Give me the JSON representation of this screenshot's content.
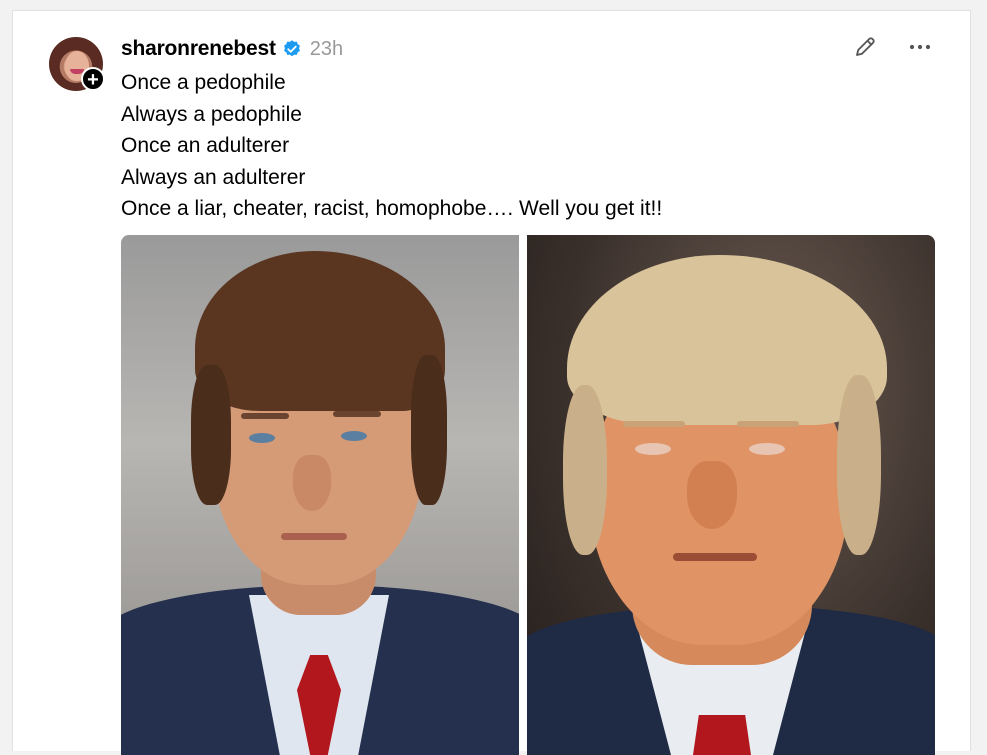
{
  "post": {
    "username": "sharonrenebest",
    "time": "23h",
    "verified": true,
    "lines": [
      "Once a pedophile",
      "Always a pedophile",
      "Once an adulterer",
      "Always an adulterer",
      "Once a liar, cheater, racist, homophobe…. Well you get it!!"
    ]
  },
  "icons": {
    "verified": "verified-badge-icon",
    "edit": "pencil-icon",
    "more": "more-horizontal-icon",
    "follow": "plus-icon"
  },
  "colors": {
    "verified_blue": "#1d9bf0",
    "timestamp": "#999999",
    "tie_red": "#b3171e",
    "suit_navy": "#1f2a44"
  }
}
